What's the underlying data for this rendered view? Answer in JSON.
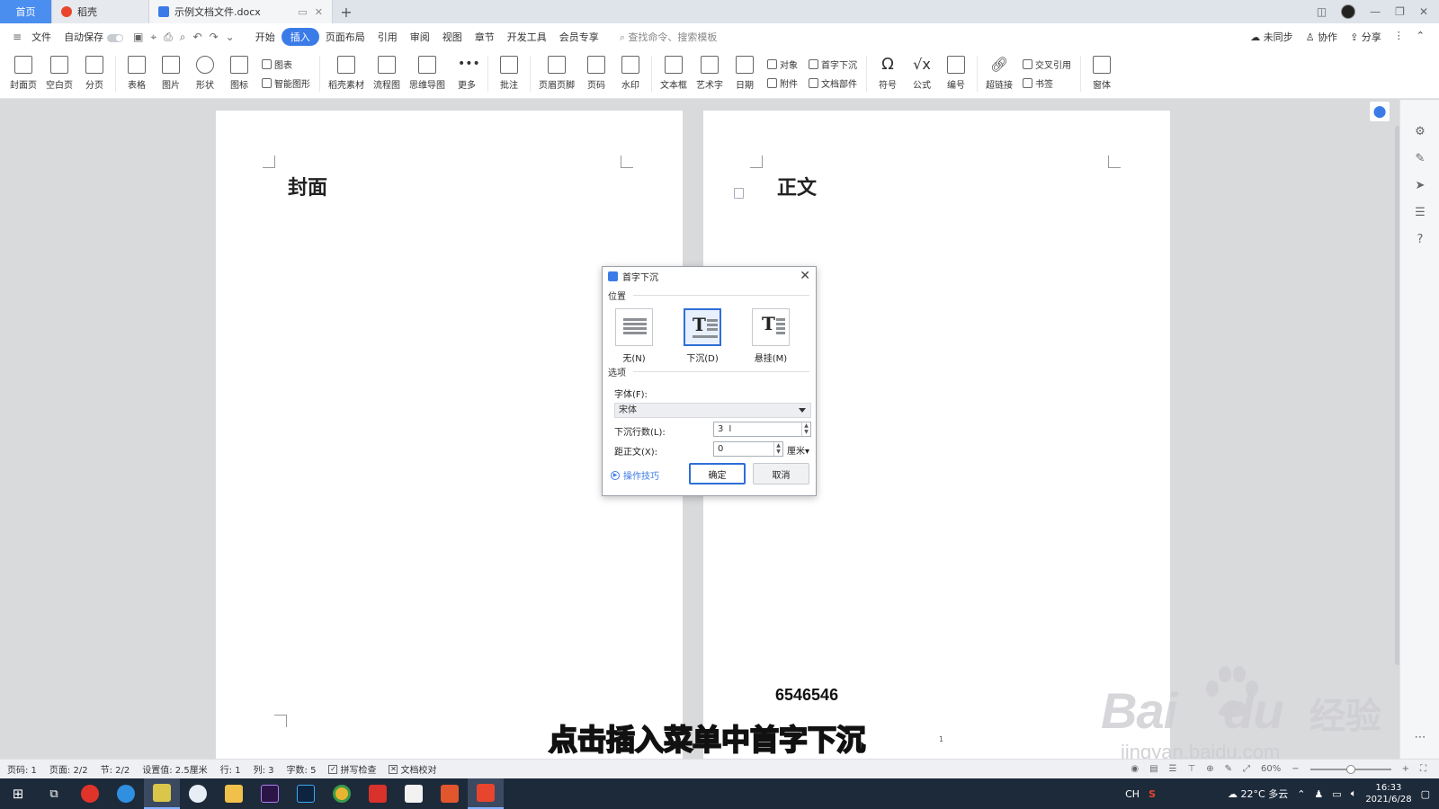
{
  "tabs": {
    "home": "首页",
    "daoke": "稻壳",
    "document": "示例文档文件.docx",
    "add": "+"
  },
  "menubar": {
    "file": "文件",
    "autosave": "自动保存",
    "items": [
      "开始",
      "插入",
      "页面布局",
      "引用",
      "审阅",
      "视图",
      "章节",
      "开发工具",
      "会员专享"
    ],
    "active_item": "插入",
    "search_placeholder": "查找命令、搜索模板",
    "right": [
      "未同步",
      "协作",
      "分享"
    ]
  },
  "ribbon": {
    "big_buttons_1": [
      "封面页",
      "空白页",
      "分页",
      "表格",
      "图片",
      "形状",
      "图标"
    ],
    "group_chart": [
      "图表",
      "智能图形"
    ],
    "big_buttons_2": [
      "稻壳素材",
      "流程图",
      "思维导图",
      "更多",
      "批注",
      "页眉页脚",
      "页码",
      "水印",
      "文本框",
      "艺术字",
      "日期"
    ],
    "group_object": [
      "对象",
      "附件"
    ],
    "group_dropcap": [
      "首字下沉",
      "文档部件"
    ],
    "big_buttons_3": [
      "符号",
      "公式",
      "编号",
      "超链接"
    ],
    "group_link": [
      "交叉引用",
      "书签"
    ],
    "big_buttons_4": [
      "窗体"
    ]
  },
  "document": {
    "left_heading": "封面",
    "right_heading": "正文",
    "page_number_text": "6546546",
    "footer_mark": "1"
  },
  "dialog": {
    "title": "首字下沉",
    "section_position": "位置",
    "options": [
      {
        "label": "无(N)",
        "selected": false
      },
      {
        "label": "下沉(D)",
        "selected": true
      },
      {
        "label": "悬挂(M)",
        "selected": false
      }
    ],
    "section_options": "选项",
    "font_label": "字体(F):",
    "font_value": "宋体",
    "lines_label": "下沉行数(L):",
    "lines_value": "3",
    "distance_label": "距正文(X):",
    "distance_value": "0",
    "distance_unit": "厘米",
    "tips": "操作技巧",
    "ok": "确定",
    "cancel": "取消"
  },
  "caption": "点击插入菜单中首字下沉",
  "watermark": {
    "brand": "Bai",
    "brand_tail": "du",
    "cn": "经验",
    "url": "jingyan.baidu.com"
  },
  "statusbar": {
    "page_code": "页码: 1",
    "pages": "页面: 2/2",
    "section": "节: 2/2",
    "setting": "设置值: 2.5厘米",
    "row": "行: 1",
    "col": "列: 3",
    "words": "字数: 5",
    "spell": "拼写检查",
    "proof": "文档校对",
    "zoom": "60%"
  },
  "taskbar": {
    "ime": "CH",
    "weather": "22°C 多云",
    "time": "16:33",
    "date": "2021/6/28"
  },
  "colors": {
    "accent": "#3b7be8",
    "taskbar": "#1d2a3a"
  }
}
